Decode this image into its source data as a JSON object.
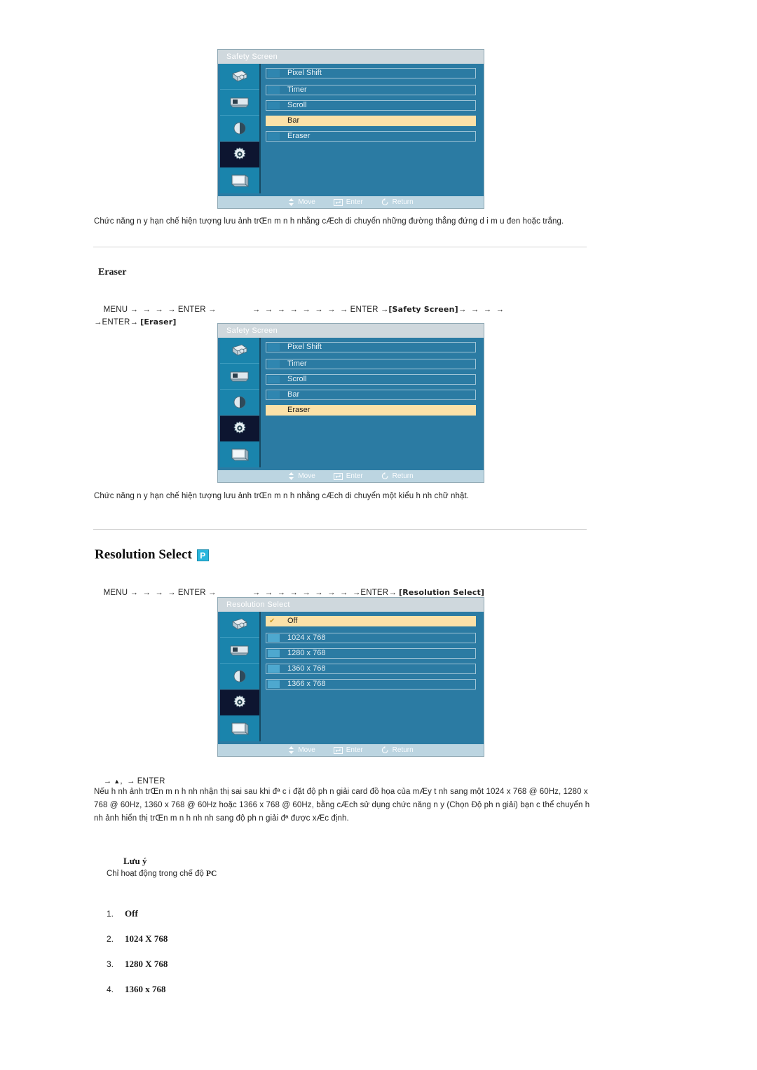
{
  "sections": {
    "bar_caption": "Chức năng n y hạn chế hiện tượng lưu ảnh trŒn m n h nhằng cÆch di chuyển những đường thẳng đứng d i m u đen hoặc trắng.",
    "eraser_heading": "Eraser",
    "eraser_caption": "Chức năng n y hạn chế hiện tượng lưu ảnh trŒn m n h nhằng cÆch di chuyển một kiểu h nh chữ nhật.",
    "resolution_heading": "Resolution Select",
    "resolution_badge": "P",
    "resolution_paragraph": "Nếu h nh ảnh trŒn m n h nh nhận thị sai sau khi đª c i đặt độ ph n giải card đồ họa của mÆy t nh sang một 1024 x 768 @ 60Hz, 1280 x 768 @ 60Hz, 1360 x 768 @ 60Hz hoặc 1366 x 768 @ 60Hz, bằng cÆch sử dụng chức năng n y (Chọn Độ ph n giải) bạn c  thể chuyển h nh ảnh hiển thị trŒn m n h nh nh sang độ ph n giải đª được xÆc định."
  },
  "menu_paths": {
    "eraser": {
      "start": "MENU",
      "enter": "ENTER",
      "enter2": "ENTER",
      "bracket1": "[Safety Screen]",
      "enter3": "ENTER",
      "bracket2": "[Eraser]"
    },
    "resolution": {
      "start": "MENU",
      "enter": "ENTER",
      "enter2": "ENTER",
      "bracket1": "[Resolution Select]"
    },
    "after_osd": {
      "text": "ENTER",
      "up_arrow": "▲"
    }
  },
  "osd_safety_bar": {
    "title": "Safety Screen",
    "items": [
      {
        "label": "Pixel Shift",
        "selected": false
      },
      {
        "label": "Timer",
        "selected": false
      },
      {
        "label": "Scroll",
        "selected": false
      },
      {
        "label": "Bar",
        "selected": true
      },
      {
        "label": "Eraser",
        "selected": false
      }
    ],
    "footer": {
      "move": "Move",
      "enter": "Enter",
      "return": "Return"
    },
    "active_sidebar_index": 3
  },
  "osd_safety_eraser": {
    "title": "Safety Screen",
    "items": [
      {
        "label": "Pixel Shift",
        "selected": false
      },
      {
        "label": "Timer",
        "selected": false
      },
      {
        "label": "Scroll",
        "selected": false
      },
      {
        "label": "Bar",
        "selected": false
      },
      {
        "label": "Eraser",
        "selected": true
      }
    ],
    "footer": {
      "move": "Move",
      "enter": "Enter",
      "return": "Return"
    },
    "active_sidebar_index": 3
  },
  "osd_resolution": {
    "title": "Resolution Select",
    "items": [
      {
        "label": "Off",
        "selected": true,
        "check": "✔"
      },
      {
        "label": "1024 x 768",
        "selected": false
      },
      {
        "label": "1280 x 768",
        "selected": false
      },
      {
        "label": "1360 x 768",
        "selected": false
      },
      {
        "label": "1366 x 768",
        "selected": false
      }
    ],
    "footer": {
      "move": "Move",
      "enter": "Enter",
      "return": "Return"
    },
    "active_sidebar_index": 3
  },
  "note": {
    "title": "Lưu ý",
    "body_prefix": "Chỉ hoạt động trong chế độ ",
    "body_bold": "PC"
  },
  "options_list": [
    {
      "index": "1.",
      "value": "Off"
    },
    {
      "index": "2.",
      "value": "1024 X 768"
    },
    {
      "index": "3.",
      "value": "1280 X 768"
    },
    {
      "index": "4.",
      "value": "1360 x 768"
    }
  ],
  "colors": {
    "osd_bg": "#2b7ba3",
    "osd_sidebar": "#1a84ac",
    "osd_sidebar_active": "#0d1530",
    "osd_highlight": "#fbe1a8",
    "osd_title_bar": "#cfd8dd",
    "osd_footer": "#bcd5e1",
    "badge": "#29b6dd"
  }
}
